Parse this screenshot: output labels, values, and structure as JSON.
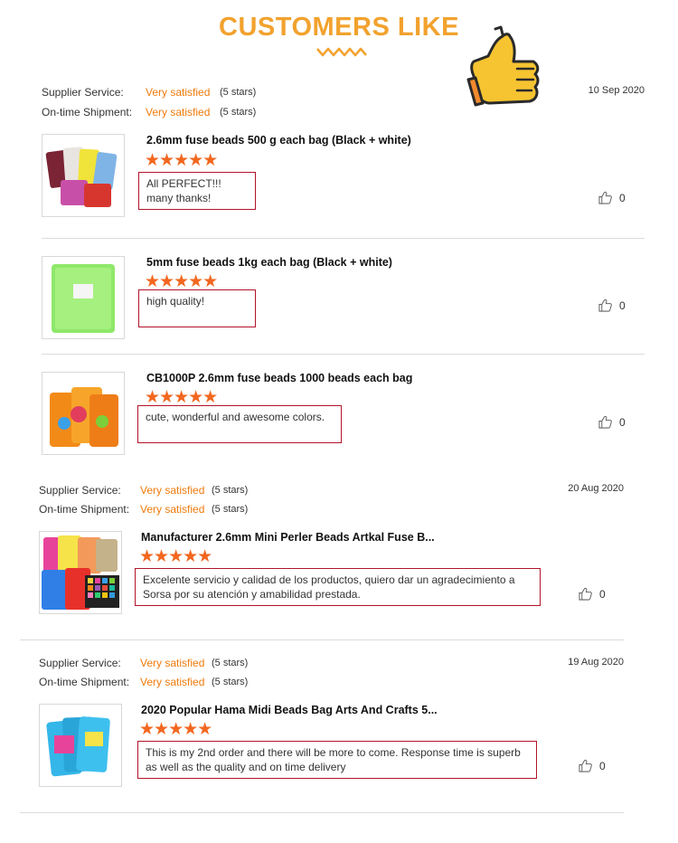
{
  "header": {
    "title": "CUSTOMERS LIKE"
  },
  "colors": {
    "accent": "#f2a22e",
    "orange_text": "#ee7b0c",
    "star": "#f2671f",
    "box_border": "#b2132a"
  },
  "labels": {
    "supplier_service": "Supplier Service:",
    "ontime_shipment": "On-time Shipment:",
    "very_satisfied": "Very satisfied",
    "five_stars": "(5 stars)"
  },
  "stars_glyph": "★★★★★",
  "orders": [
    {
      "date": "10 Sep 2020"
    },
    {
      "date": "20 Aug 2020"
    },
    {
      "date": "19 Aug 2020"
    }
  ],
  "reviews": [
    {
      "title": "2.6mm fuse beads 500 g each bag (Black + white)",
      "rating": 5,
      "text": "All PERFECT!!!\nmany thanks!",
      "likes": "0"
    },
    {
      "title": "5mm fuse beads 1kg each bag (Black + white)",
      "rating": 5,
      "text": "high quality!",
      "likes": "0"
    },
    {
      "title": "CB1000P 2.6mm fuse beads 1000 beads each bag",
      "rating": 5,
      "text": "cute, wonderful and awesome colors.",
      "likes": "0"
    },
    {
      "title": "Manufacturer 2.6mm Mini Perler Beads Artkal Fuse B...",
      "rating": 5,
      "text": "Excelente servicio y calidad de los productos, quiero dar un agradecimiento a Sorsa por su atención y amabilidad prestada.",
      "likes": "0"
    },
    {
      "title": "2020 Popular Hama Midi Beads Bag Arts And Crafts 5...",
      "rating": 5,
      "text": "This is my 2nd order and there will be more to come. Response time is superb as well as the quality and on time delivery",
      "likes": "0"
    }
  ],
  "icons": {
    "like": "thumbs-up-icon",
    "decoration": "thumbs-up-cartoon"
  }
}
